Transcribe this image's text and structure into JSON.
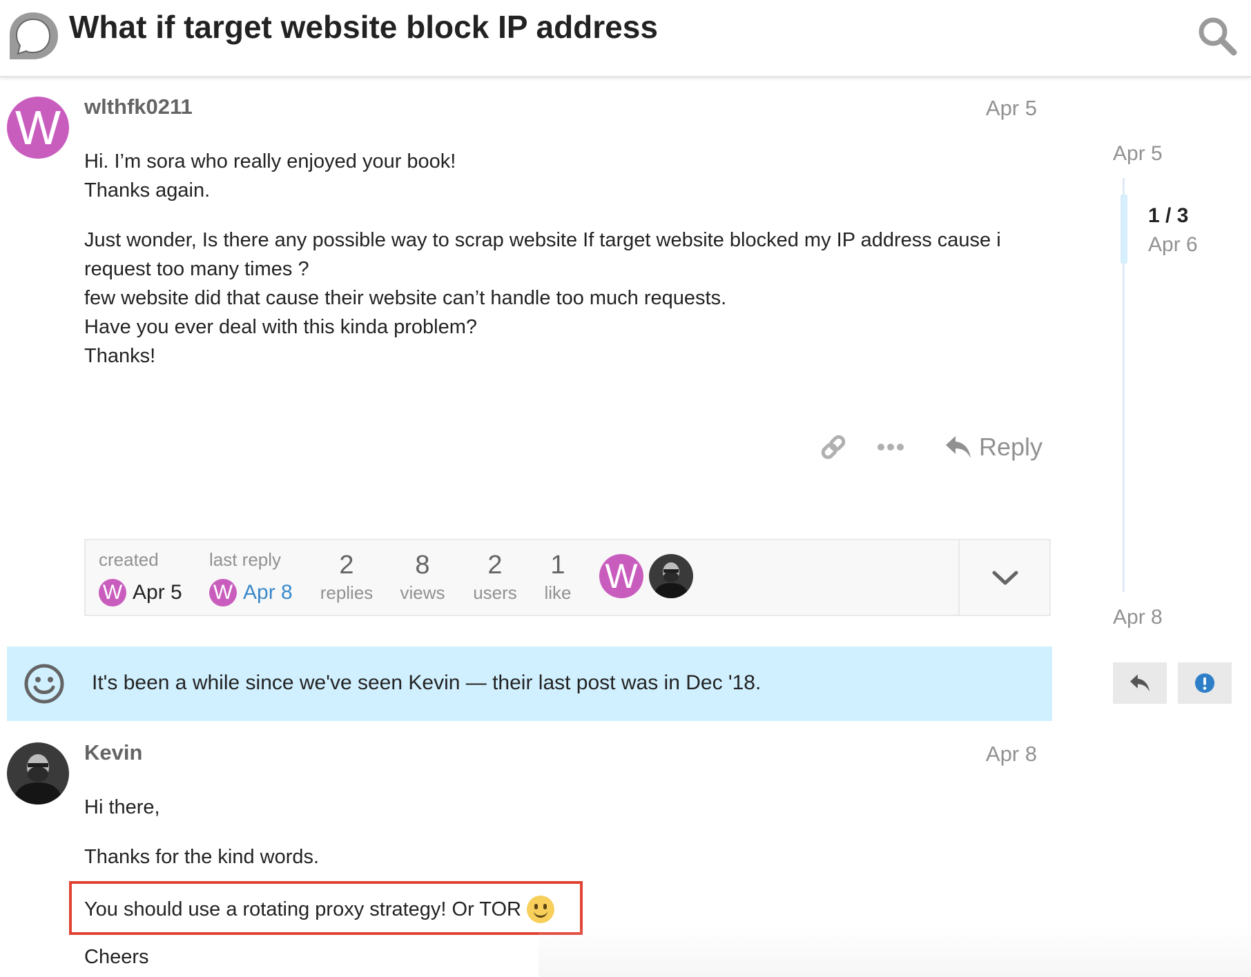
{
  "header": {
    "title": "What if target website block IP address",
    "logo_icon": "discourse-logo-icon",
    "search_icon": "search-icon"
  },
  "posts": [
    {
      "username": "wlthfk0211",
      "avatar_letter": "W",
      "avatar_color": "#c95dbe",
      "date": "Apr 5",
      "lines": [
        "Hi. I’m sora who really enjoyed your book!",
        "Thanks again.",
        "Just wonder, Is there any possible way to scrap website If target website blocked my IP address cause i",
        "request too many times ?",
        "few website did that cause their website can’t handle too much requests.",
        "Have you ever deal with this kinda problem?",
        "Thanks!"
      ]
    },
    {
      "username": "Kevin",
      "date": "Apr 8",
      "lines": [
        "Hi there,",
        "Thanks for the kind words.",
        "You should use a rotating proxy strategy! Or TOR",
        "Cheers"
      ],
      "emoji": "🙂"
    }
  ],
  "actions": {
    "reply_label": "Reply",
    "icons": [
      "link-icon",
      "more-icon",
      "reply-arrow-icon"
    ]
  },
  "topic_map": {
    "created_label": "created",
    "created_date": "Apr 5",
    "last_reply_label": "last reply",
    "last_reply_date": "Apr 8",
    "replies": "2",
    "replies_label": "replies",
    "views": "8",
    "views_label": "views",
    "users": "2",
    "users_label": "users",
    "likes": "1",
    "likes_label": "like",
    "avatar_letter": "W",
    "link_color": "#3a89c9"
  },
  "notice": {
    "text": "It's been a while since we've seen Kevin — their last post was in Dec '18.",
    "icon": "smile-icon",
    "bg_color": "#d1f0ff"
  },
  "timeline": {
    "start_date": "Apr 5",
    "count": "1 / 3",
    "handle_date": "Apr 6",
    "end_date": "Apr 8",
    "progress": 0.333
  },
  "highlight_color": "#e04233"
}
